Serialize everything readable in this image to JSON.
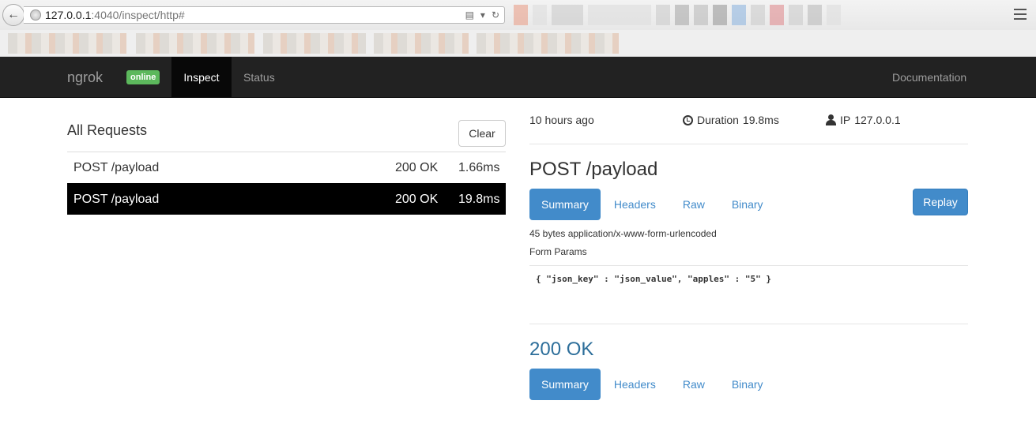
{
  "browser": {
    "url_host": "127.0.0.1",
    "url_rest": ":4040/inspect/http#"
  },
  "navbar": {
    "brand": "ngrok",
    "status_badge": "online",
    "tabs": [
      {
        "label": "Inspect",
        "active": true
      },
      {
        "label": "Status",
        "active": false
      }
    ],
    "docs": "Documentation"
  },
  "requests": {
    "title": "All Requests",
    "clear_label": "Clear",
    "rows": [
      {
        "method_path": "POST /payload",
        "status": "200 OK",
        "duration": "1.66ms",
        "selected": false
      },
      {
        "method_path": "POST /payload",
        "status": "200 OK",
        "duration": "19.8ms",
        "selected": true
      }
    ]
  },
  "detail": {
    "time_ago": "10 hours ago",
    "duration_label": "Duration",
    "duration_value": "19.8ms",
    "ip_label": "IP",
    "ip_value": "127.0.0.1",
    "request_title": "POST /payload",
    "request_tabs": [
      "Summary",
      "Headers",
      "Raw",
      "Binary"
    ],
    "replay_label": "Replay",
    "body_info": "45 bytes application/x-www-form-urlencoded",
    "form_params_label": "Form Params",
    "body_code": "{ \"json_key\" : \"json_value\", \"apples\" : \"5\" }",
    "response_title": "200 OK",
    "response_tabs": [
      "Summary",
      "Headers",
      "Raw",
      "Binary"
    ]
  },
  "colors": {
    "navbar_bg": "#222222",
    "online_badge": "#5cb85c",
    "primary": "#428bca",
    "selected_row": "#000000"
  }
}
